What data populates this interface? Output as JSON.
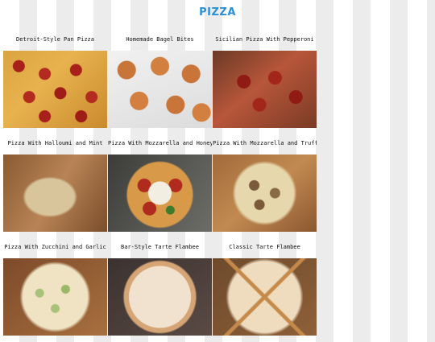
{
  "page": {
    "title": "PIZZA"
  },
  "recipes": [
    {
      "title": "Detroit-Style Pan Pizza",
      "image": "detroit-style-pan-pizza-photo"
    },
    {
      "title": "Homemade Bagel Bites",
      "image": "homemade-bagel-bites-photo"
    },
    {
      "title": "Sicilian Pizza With Pepperoni",
      "image": "sicilian-pizza-pepperoni-photo"
    },
    {
      "title": "Pizza With Halloumi and Mint",
      "image": "pizza-halloumi-mint-photo"
    },
    {
      "title": "Pizza With Mozzarella and Honey",
      "image": "pizza-mozzarella-honey-photo"
    },
    {
      "title": "Pizza With Mozzarella and Truffle",
      "image": "pizza-mozzarella-truffle-photo"
    },
    {
      "title": "Pizza With Zucchini and Garlic",
      "image": "pizza-zucchini-garlic-photo"
    },
    {
      "title": "Bar-Style Tarte Flambee",
      "image": "bar-style-tarte-flambee-photo"
    },
    {
      "title": "Classic Tarte Flambee",
      "image": "classic-tarte-flambee-photo"
    }
  ],
  "colors": {
    "title": "#2a8fd6",
    "stripe": "#ececec"
  }
}
